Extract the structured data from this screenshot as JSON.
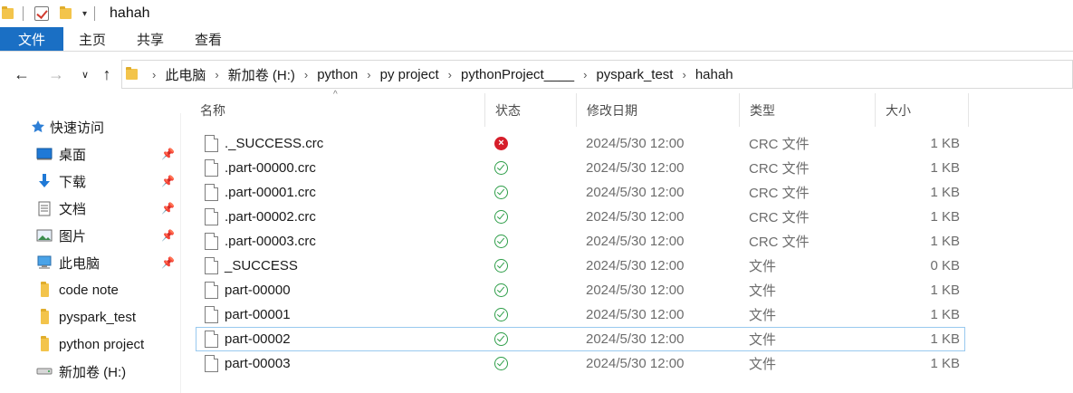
{
  "window": {
    "title": "hahah"
  },
  "ribbon": {
    "tabs": [
      "文件",
      "主页",
      "共享",
      "查看"
    ]
  },
  "breadcrumb": [
    "此电脑",
    "新加卷 (H:)",
    "python",
    "py project",
    "pythonProject____",
    "pyspark_test",
    "hahah"
  ],
  "sidebar": {
    "items": [
      {
        "label": "快速访问",
        "icon": "star-icon",
        "pinned": false
      },
      {
        "label": "桌面",
        "icon": "desktop-icon",
        "pinned": true
      },
      {
        "label": "下载",
        "icon": "download-icon",
        "pinned": true
      },
      {
        "label": "文档",
        "icon": "document-icon",
        "pinned": true
      },
      {
        "label": "图片",
        "icon": "picture-icon",
        "pinned": true
      },
      {
        "label": "此电脑",
        "icon": "computer-icon",
        "pinned": true
      },
      {
        "label": "code note",
        "icon": "folder-icon",
        "pinned": false
      },
      {
        "label": "pyspark_test",
        "icon": "folder-icon",
        "pinned": false
      },
      {
        "label": "python project",
        "icon": "folder-icon",
        "pinned": false
      },
      {
        "label": "新加卷 (H:)",
        "icon": "drive-icon",
        "pinned": false
      }
    ]
  },
  "columns": {
    "name": "名称",
    "status": "状态",
    "date": "修改日期",
    "type": "类型",
    "size": "大小"
  },
  "files": [
    {
      "name": "._SUCCESS.crc",
      "status": "error",
      "date": "2024/5/30 12:00",
      "type": "CRC 文件",
      "size": "1 KB"
    },
    {
      "name": ".part-00000.crc",
      "status": "ok",
      "date": "2024/5/30 12:00",
      "type": "CRC 文件",
      "size": "1 KB"
    },
    {
      "name": ".part-00001.crc",
      "status": "ok",
      "date": "2024/5/30 12:00",
      "type": "CRC 文件",
      "size": "1 KB"
    },
    {
      "name": ".part-00002.crc",
      "status": "ok",
      "date": "2024/5/30 12:00",
      "type": "CRC 文件",
      "size": "1 KB"
    },
    {
      "name": ".part-00003.crc",
      "status": "ok",
      "date": "2024/5/30 12:00",
      "type": "CRC 文件",
      "size": "1 KB"
    },
    {
      "name": "_SUCCESS",
      "status": "ok",
      "date": "2024/5/30 12:00",
      "type": "文件",
      "size": "0 KB"
    },
    {
      "name": "part-00000",
      "status": "ok",
      "date": "2024/5/30 12:00",
      "type": "文件",
      "size": "1 KB"
    },
    {
      "name": "part-00001",
      "status": "ok",
      "date": "2024/5/30 12:00",
      "type": "文件",
      "size": "1 KB"
    },
    {
      "name": "part-00002",
      "status": "ok",
      "date": "2024/5/30 12:00",
      "type": "文件",
      "size": "1 KB",
      "selected": true
    },
    {
      "name": "part-00003",
      "status": "ok",
      "date": "2024/5/30 12:00",
      "type": "文件",
      "size": "1 KB"
    }
  ],
  "colors": {
    "file_tab": "#1a6fc4",
    "status_ok": "#2e9e49",
    "status_error": "#d61e2a",
    "selection_border": "#99c9ef"
  }
}
